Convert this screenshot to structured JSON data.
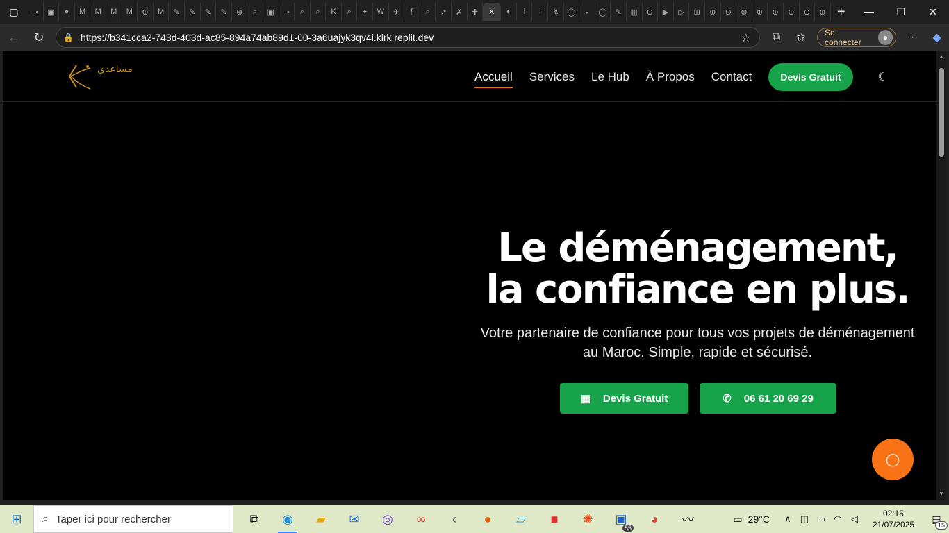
{
  "browser": {
    "tab_icons": [
      "tab-icon-1",
      "tab-icon-2",
      "tab-icon-3",
      "tab-icon-4",
      "tab-icon-5",
      "tab-icon-6",
      "tab-icon-7",
      "tab-icon-8",
      "tab-icon-9",
      "tab-icon-10",
      "tab-icon-11",
      "tab-icon-12",
      "tab-icon-13",
      "tab-icon-14",
      "tab-icon-15",
      "tab-icon-16",
      "tab-icon-17",
      "tab-icon-18",
      "tab-icon-19",
      "tab-icon-20",
      "tab-icon-21",
      "tab-icon-22",
      "tab-icon-23",
      "tab-icon-24",
      "tab-icon-25",
      "tab-icon-26",
      "tab-icon-27",
      "tab-icon-28",
      "tab-icon-29",
      "tab-icon-30",
      "tab-icon-31",
      "tab-icon-32",
      "tab-icon-33",
      "tab-icon-34",
      "tab-icon-35",
      "tab-icon-36",
      "tab-icon-37",
      "tab-icon-38",
      "tab-icon-39",
      "tab-icon-40",
      "tab-icon-41",
      "tab-icon-42",
      "tab-icon-43",
      "tab-icon-44",
      "tab-icon-45",
      "tab-icon-46",
      "tab-icon-47",
      "tab-icon-48",
      "tab-icon-49",
      "tab-icon-50",
      "tab-icon-51"
    ],
    "url_scheme": "https://",
    "url_host": "b341cca2-743d-403d-ac85-894a74ab89d1-00-3a6uajyk3qv4i.kirk.replit.dev",
    "signin_label": "Se connecter"
  },
  "site": {
    "logo_text": "مساعدي",
    "nav": [
      {
        "label": "Accueil",
        "active": true
      },
      {
        "label": "Services"
      },
      {
        "label": "Le Hub"
      },
      {
        "label": "À Propos"
      },
      {
        "label": "Contact"
      }
    ],
    "nav_cta": "Devis Gratuit",
    "hero": {
      "title_line1": "Le déménagement,",
      "title_line2": "la confiance en plus.",
      "subtitle": "Votre partenaire de confiance pour tous vos projets de déménagement au Maroc. Simple, rapide et sécurisé.",
      "btn_quote": "Devis Gratuit",
      "btn_phone": "06 61 20 69 29"
    },
    "colors": {
      "accent_green": "#16a34a",
      "accent_orange": "#f97316",
      "logo_gold": "#c9951f"
    }
  },
  "taskbar": {
    "search_placeholder": "Taper ici pour rechercher",
    "app_badge": "55",
    "temperature": "29°C",
    "time": "02:15",
    "date": "21/07/2025",
    "notifications": "15"
  }
}
